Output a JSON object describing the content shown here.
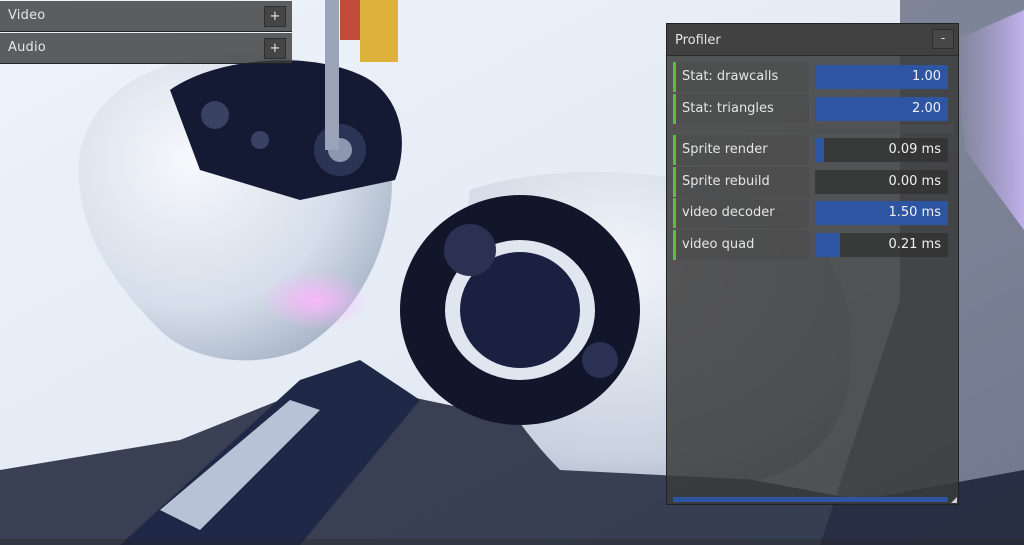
{
  "panels": {
    "video": {
      "label": "Video",
      "toggle": "+"
    },
    "audio": {
      "label": "Audio",
      "toggle": "+"
    }
  },
  "profiler": {
    "title": "Profiler",
    "collapse": "-",
    "stats": [
      {
        "label": "Stat: drawcalls",
        "value": "1.00",
        "fill": 1.0
      },
      {
        "label": "Stat: triangles",
        "value": "2.00",
        "fill": 1.0
      }
    ],
    "timings": [
      {
        "label": "Sprite render",
        "value": "0.09 ms",
        "fill": 0.07
      },
      {
        "label": "Sprite rebuild",
        "value": "0.00 ms",
        "fill": 0.0
      },
      {
        "label": "video decoder",
        "value": "1.50 ms",
        "fill": 1.0
      },
      {
        "label": "video quad",
        "value": "0.21 ms",
        "fill": 0.19
      }
    ]
  },
  "colors": {
    "accent_bar": "#2e55a2",
    "row_marker": "#5cbf3d",
    "panel_bg": "#3c3c3c"
  }
}
